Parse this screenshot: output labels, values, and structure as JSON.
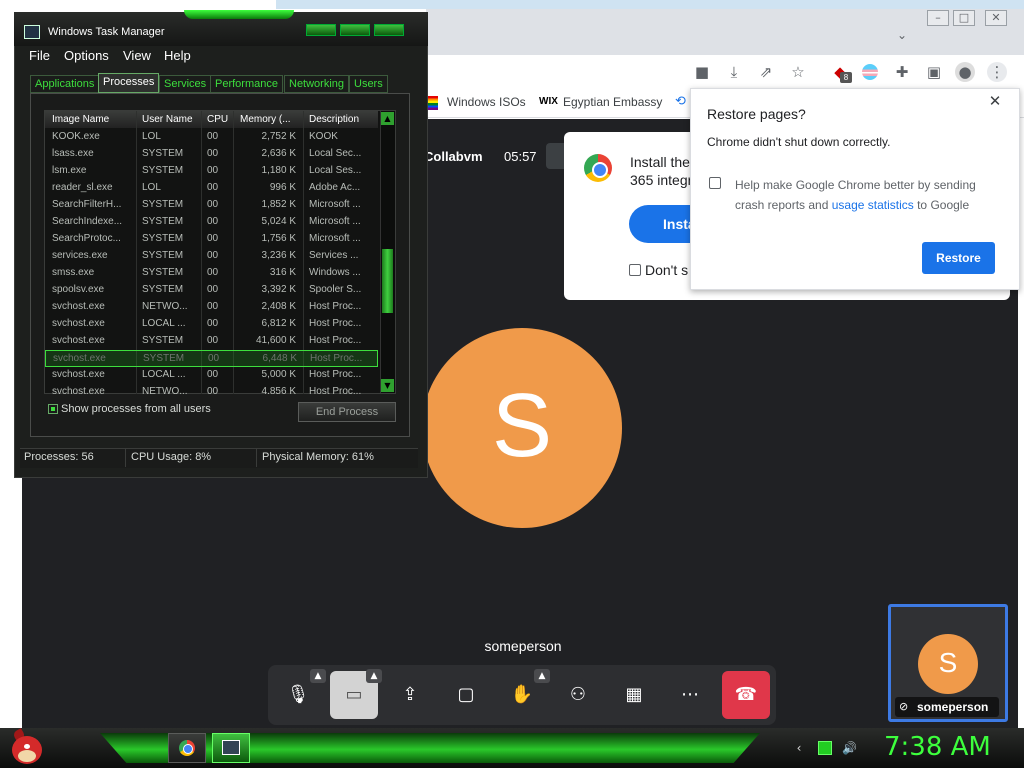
{
  "chrome": {
    "bookmarks": [
      "Windows ISOs",
      "Egyptian Embassy"
    ],
    "window_controls": [
      "–",
      "□",
      "✕"
    ],
    "toolbar_icons": [
      "camera-icon",
      "download-icon",
      "share-icon",
      "star-icon",
      "extension-badge-icon",
      "profile-flag-icon",
      "puzzle-icon",
      "sidebar-icon",
      "profile-icon",
      "menu-icon"
    ],
    "extension_badge": "8"
  },
  "meeting": {
    "title": "Collabvm",
    "time": "05:57",
    "participant_initial": "S",
    "participant_name": "someperson",
    "self_initial": "S",
    "self_name": "someperson",
    "accent_color": "#f09a4a",
    "end_call_color": "#e0374a"
  },
  "install_popup": {
    "text": "Install the\n365 integr",
    "button": "Insta",
    "dont_show": "Don't s"
  },
  "restore_dialog": {
    "title": "Restore pages?",
    "message": "Chrome didn't shut down correctly.",
    "help_prefix": "Help make Google Chrome better by sending crash reports and ",
    "help_link": "usage statistics",
    "help_suffix": " to Google",
    "button": "Restore"
  },
  "task_manager": {
    "title": "Windows Task Manager",
    "menus": [
      "File",
      "Options",
      "View",
      "Help"
    ],
    "tabs": [
      "Applications",
      "Processes",
      "Services",
      "Performance",
      "Networking",
      "Users"
    ],
    "active_tab": "Processes",
    "columns": [
      "Image Name",
      "User Name",
      "CPU",
      "Memory (...",
      "Description"
    ],
    "rows": [
      [
        "KOOK.exe",
        "LOL",
        "00",
        "2,752 K",
        "KOOK"
      ],
      [
        "lsass.exe",
        "SYSTEM",
        "00",
        "2,636 K",
        "Local Sec..."
      ],
      [
        "lsm.exe",
        "SYSTEM",
        "00",
        "1,180 K",
        "Local Ses..."
      ],
      [
        "reader_sl.exe",
        "LOL",
        "00",
        "996 K",
        "Adobe Ac..."
      ],
      [
        "SearchFilterH...",
        "SYSTEM",
        "00",
        "1,852 K",
        "Microsoft ..."
      ],
      [
        "SearchIndexe...",
        "SYSTEM",
        "00",
        "5,024 K",
        "Microsoft ..."
      ],
      [
        "SearchProtoc...",
        "SYSTEM",
        "00",
        "1,756 K",
        "Microsoft ..."
      ],
      [
        "services.exe",
        "SYSTEM",
        "00",
        "3,236 K",
        "Services ..."
      ],
      [
        "smss.exe",
        "SYSTEM",
        "00",
        "316 K",
        "Windows ..."
      ],
      [
        "spoolsv.exe",
        "SYSTEM",
        "00",
        "3,392 K",
        "Spooler S..."
      ],
      [
        "svchost.exe",
        "NETWO...",
        "00",
        "2,408 K",
        "Host Proc..."
      ],
      [
        "svchost.exe",
        "LOCAL ...",
        "00",
        "6,812 K",
        "Host Proc..."
      ],
      [
        "svchost.exe",
        "SYSTEM",
        "00",
        "41,600 K",
        "Host Proc..."
      ],
      [
        "svchost.exe",
        "SYSTEM",
        "00",
        "6,448 K",
        "Host Proc..."
      ],
      [
        "svchost.exe",
        "LOCAL ...",
        "00",
        "5,000 K",
        "Host Proc..."
      ],
      [
        "svchost.exe",
        "NETWO...",
        "00",
        "4,856 K",
        "Host Proc..."
      ]
    ],
    "selected_row": 13,
    "show_all_label": "Show processes from all users",
    "end_process": "End Process",
    "status": {
      "processes": "Processes: 56",
      "cpu": "CPU Usage: 8%",
      "memory": "Physical Memory: 61%"
    }
  },
  "taskbar": {
    "clock": "7:38 AM",
    "apps": [
      "chrome-icon",
      "task-manager-icon"
    ]
  }
}
